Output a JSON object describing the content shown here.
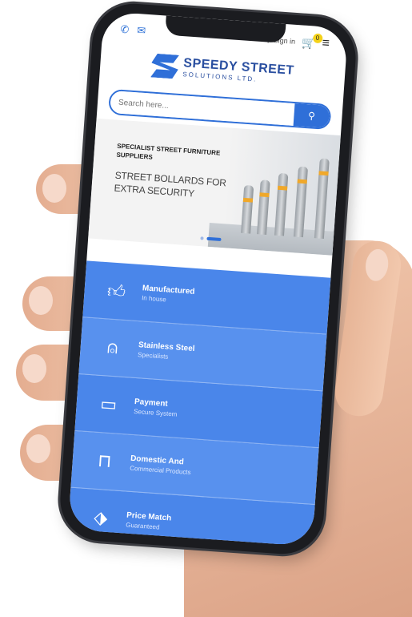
{
  "status": {
    "signin_label": "Sign in",
    "cart_count": "0"
  },
  "logo": {
    "line1": "SPEEDY STREET",
    "line2": "SOLUTIONS LTD."
  },
  "search": {
    "placeholder": "Search here..."
  },
  "banner": {
    "subtitle": "SPECIALIST STREET FURNITURE SUPPLIERS",
    "title": "STREET BOLLARDS FOR EXTRA SECURITY",
    "active_slide": 2,
    "slide_count": 2
  },
  "features": [
    {
      "icon": "thumbs-up-icon",
      "title": "Manufactured",
      "subtitle": "In house"
    },
    {
      "icon": "user-icon",
      "title": "Stainless Steel",
      "subtitle": "Specialists"
    },
    {
      "icon": "payment-icon",
      "title": "Payment",
      "subtitle": "Secure System"
    },
    {
      "icon": "shopping-bag-icon",
      "title": "Domestic And",
      "subtitle": "Commercial Products"
    },
    {
      "icon": "tag-icon",
      "title": "Price Match",
      "subtitle": "Guaranteed"
    }
  ],
  "colors": {
    "brand_blue": "#2f6fd8",
    "feature_blue": "#4a86ea",
    "cart_badge": "#f4d21a"
  }
}
